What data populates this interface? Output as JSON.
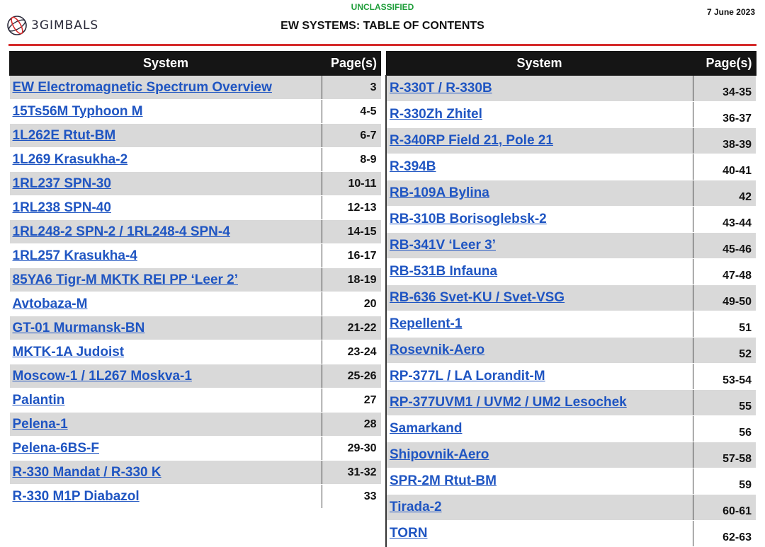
{
  "header": {
    "logo_text": "3GIMBALS",
    "classification": "UNCLASSIFIED",
    "title": "EW SYSTEMS: TABLE OF CONTENTS",
    "date": "7 June 2023"
  },
  "colors": {
    "accent_line": "#d52b2b",
    "classification": "#1f9e3a",
    "link": "#1f55c2",
    "header_bg": "#151515",
    "row_shade": "#d9d9d9"
  },
  "left_table": {
    "headers": {
      "system": "System",
      "pages": "Page(s)"
    },
    "rows": [
      {
        "system": "EW Electromagnetic Spectrum Overview",
        "pages": "3"
      },
      {
        "system": "15Ts56M Typhoon M",
        "pages": "4-5"
      },
      {
        "system": "1L262E Rtut-BM",
        "pages": "6-7"
      },
      {
        "system": "1L269 Krasukha-2",
        "pages": "8-9"
      },
      {
        "system": "1RL237 SPN-30",
        "pages": "10-11"
      },
      {
        "system": "1RL238 SPN-40",
        "pages": "12-13"
      },
      {
        "system": "1RL248-2 SPN-2 / 1RL248-4 SPN-4",
        "pages": "14-15"
      },
      {
        "system": "1RL257 Krasukha-4",
        "pages": "16-17"
      },
      {
        "system": "85YA6 Tigr-M MKTK REI PP ‘Leer 2’",
        "pages": "18-19"
      },
      {
        "system": "Avtobaza-M",
        "pages": "20"
      },
      {
        "system": "GT-01 Murmansk-BN",
        "pages": "21-22"
      },
      {
        "system": "MKTK-1A Judoist",
        "pages": "23-24"
      },
      {
        "system": "Moscow-1 / 1L267 Moskva-1",
        "pages": "25-26"
      },
      {
        "system": "Palantin",
        "pages": "27"
      },
      {
        "system": "Pelena-1",
        "pages": "28"
      },
      {
        "system": "Pelena-6BS-F",
        "pages": "29-30"
      },
      {
        "system": "R-330 Mandat / R-330 K",
        "pages": "31-32"
      },
      {
        "system": "R-330 M1P Diabazol",
        "pages": "33"
      }
    ]
  },
  "right_table": {
    "headers": {
      "system": "System",
      "pages": "Page(s)"
    },
    "rows": [
      {
        "system": "R-330T / R-330B",
        "pages": "34-35"
      },
      {
        "system": "R-330Zh Zhitel",
        "pages": "36-37"
      },
      {
        "system": "R-340RP Field 21, Pole 21",
        "pages": "38-39"
      },
      {
        "system": "R-394B",
        "pages": "40-41"
      },
      {
        "system": "RB-109A Bylina",
        "pages": "42"
      },
      {
        "system": "RB-310B Borisoglebsk-2",
        "pages": "43-44"
      },
      {
        "system": "RB-341V ‘Leer 3’",
        "pages": "45-46"
      },
      {
        "system": "RB-531B Infauna",
        "pages": "47-48"
      },
      {
        "system": "RB-636 Svet-KU / Svet-VSG",
        "pages": "49-50"
      },
      {
        "system": "Repellent-1",
        "pages": "51"
      },
      {
        "system": "Rosevnik-Aero",
        "pages": "52"
      },
      {
        "system": "RP-377L / LA Lorandit-M",
        "pages": "53-54"
      },
      {
        "system": "RP-377UVM1 / UVM2 / UM2 Lesochek",
        "pages": "55"
      },
      {
        "system": "Samarkand",
        "pages": "56"
      },
      {
        "system": "Shipovnik-Aero",
        "pages": "57-58"
      },
      {
        "system": "SPR-2M Rtut-BM",
        "pages": "59"
      },
      {
        "system": "Tirada-2",
        "pages": "60-61"
      },
      {
        "system": "TORN",
        "pages": "62-63"
      }
    ]
  }
}
